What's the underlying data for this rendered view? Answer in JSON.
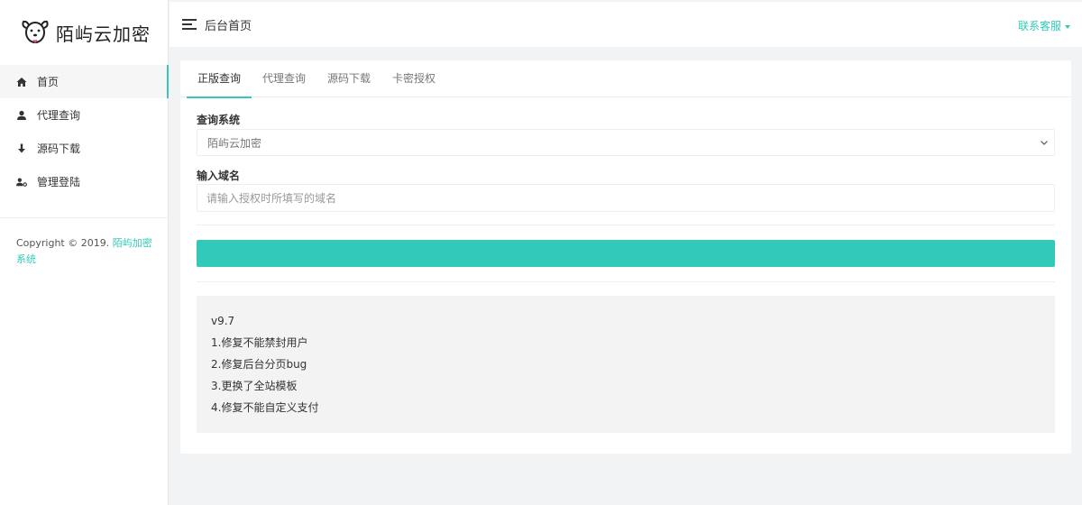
{
  "brand": {
    "name": "陌屿云加密"
  },
  "sidebar": {
    "items": [
      {
        "label": "首页",
        "icon": "home-icon",
        "active": true
      },
      {
        "label": "代理查询",
        "icon": "user-icon",
        "active": false
      },
      {
        "label": "源码下载",
        "icon": "download-icon",
        "active": false
      },
      {
        "label": "管理登陆",
        "icon": "admin-icon",
        "active": false
      }
    ],
    "copyright_prefix": "Copyright © 2019.",
    "copyright_link": "陌屿加密系统"
  },
  "topbar": {
    "title": "后台首页",
    "contact_label": "联系客服"
  },
  "tabs": [
    {
      "label": "正版查询",
      "active": true
    },
    {
      "label": "代理查询",
      "active": false
    },
    {
      "label": "源码下载",
      "active": false
    },
    {
      "label": "卡密授权",
      "active": false
    }
  ],
  "form": {
    "system_label": "查询系统",
    "system_value": "陌屿云加密",
    "domain_label": "输入域名",
    "domain_placeholder": "请输入授权时所填写的域名",
    "domain_value": "",
    "submit_label": ""
  },
  "notes": {
    "lines": [
      "v9.7",
      "1.修复不能禁封用户",
      "2.修复后台分页bug",
      "3.更换了全站模板",
      "4.修复不能自定义支付"
    ]
  },
  "colors": {
    "accent": "#33c9b8",
    "page_bg": "#f2f3f5",
    "notes_bg": "#f3f3f4"
  }
}
